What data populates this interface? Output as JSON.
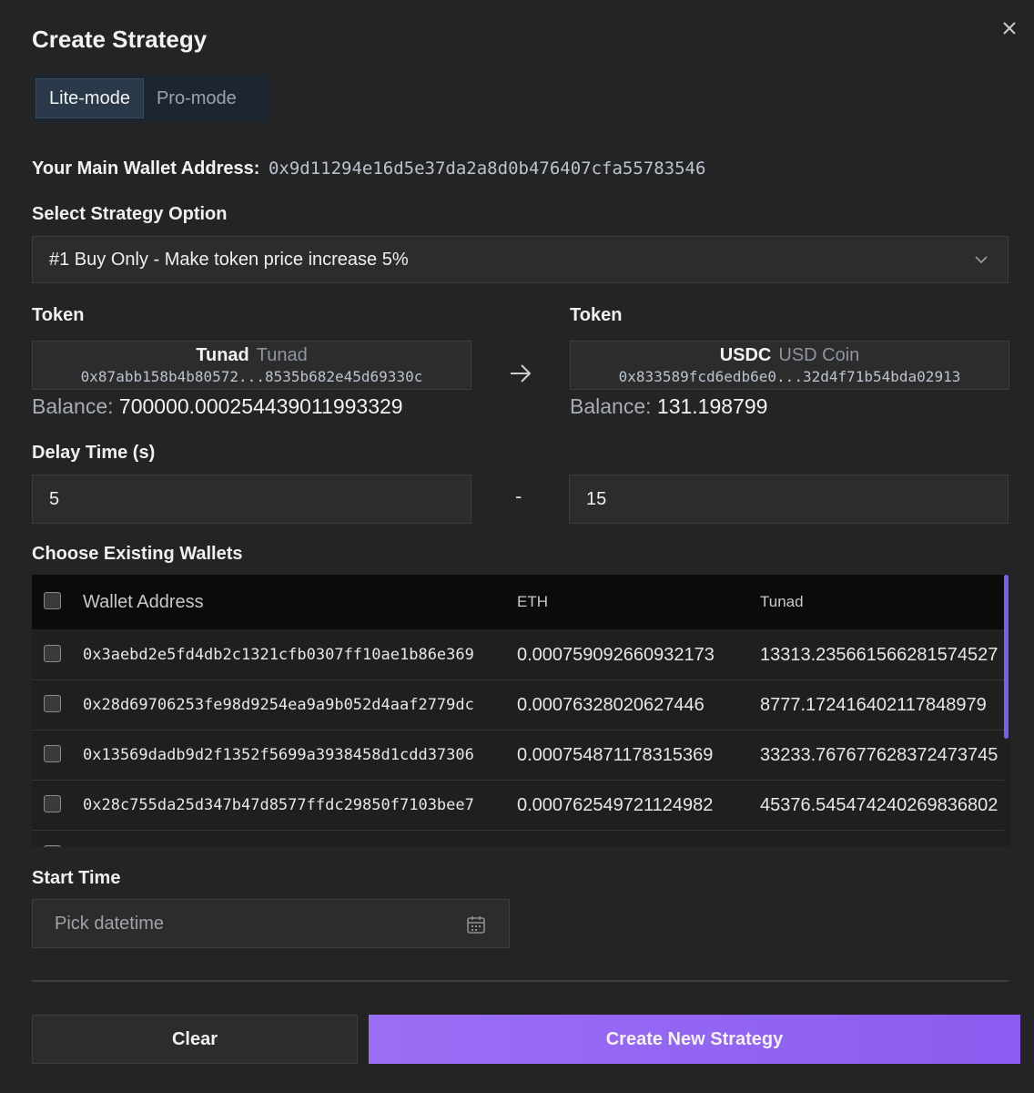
{
  "dialog": {
    "title": "Create Strategy",
    "close_icon": "close-icon"
  },
  "modes": [
    {
      "label": "Lite-mode",
      "active": true
    },
    {
      "label": "Pro-mode",
      "active": false
    }
  ],
  "wallet": {
    "label": "Your Main Wallet Address:",
    "address": "0x9d11294e16d5e37da2a8d0b476407cfa55783546"
  },
  "strategy": {
    "label": "Select Strategy Option",
    "selected": "#1 Buy Only - Make token price increase 5%"
  },
  "token_from": {
    "label": "Token",
    "symbol": "Tunad",
    "name": "Tunad",
    "address": "0x87abb158b4b80572...8535b682e45d69330c",
    "balance_label": "Balance:",
    "balance": "700000.000254439011993329"
  },
  "token_to": {
    "label": "Token",
    "symbol": "USDC",
    "name": "USD Coin",
    "address": "0x833589fcd6edb6e0...32d4f71b54bda02913",
    "balance_label": "Balance:",
    "balance": "131.198799"
  },
  "delay": {
    "label": "Delay Time (s)",
    "min": "5",
    "separator": "-",
    "max": "15"
  },
  "wallets": {
    "label": "Choose Existing Wallets",
    "columns": [
      "Wallet Address",
      "ETH",
      "Tunad"
    ],
    "rows": [
      {
        "address": "0x3aebd2e5fd4db2c1321cfb0307ff10ae1b86e369",
        "eth": "0.000759092660932173",
        "tunad": "13313.235661566281574527"
      },
      {
        "address": "0x28d69706253fe98d9254ea9a9b052d4aaf2779dc",
        "eth": "0.00076328020627446",
        "tunad": "8777.172416402117848979"
      },
      {
        "address": "0x13569dadb9d2f1352f5699a3938458d1cdd37306",
        "eth": "0.000754871178315369",
        "tunad": "33233.767677628372473745"
      },
      {
        "address": "0x28c755da25d347b47d8577ffdc29850f7103bee7",
        "eth": "0.000762549721124982",
        "tunad": "45376.545474240269836802"
      }
    ]
  },
  "start_time": {
    "label": "Start Time",
    "placeholder": "Pick datetime"
  },
  "actions": {
    "clear": "Clear",
    "create": "Create New Strategy"
  },
  "colors": {
    "accent": "#8a5cf0",
    "background": "#242424"
  }
}
